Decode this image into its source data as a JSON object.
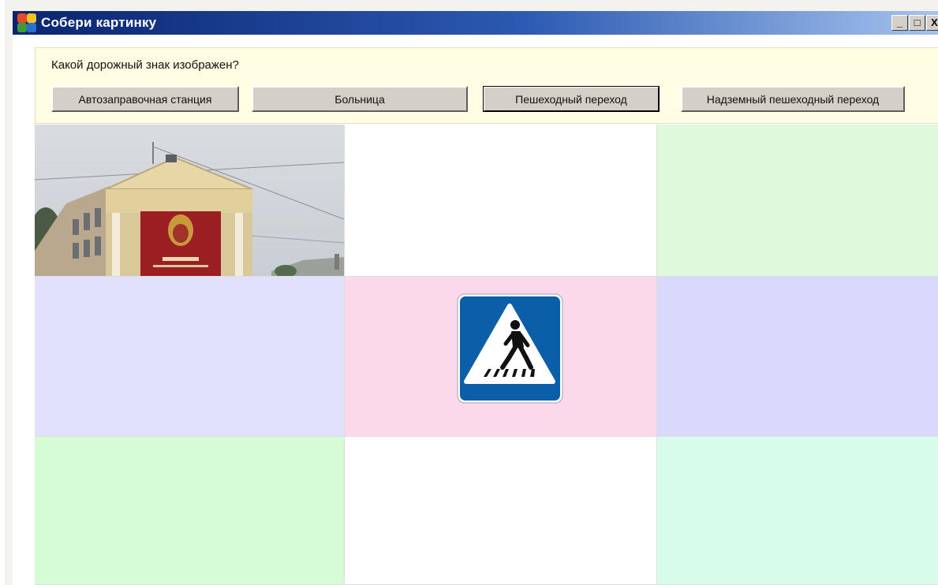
{
  "window": {
    "title": "Собери картинку",
    "controls": {
      "minimize": "_",
      "maximize": "□",
      "close": "X"
    }
  },
  "question": {
    "label": "Какой дорожный знак изображен?",
    "answers": [
      "Автозаправочная станция",
      "Больница",
      "Пешеходный переход",
      "Надземный пешеходный переход"
    ],
    "focused_answer": "Пешеходный переход"
  },
  "grid": {
    "rows": 3,
    "cols": 3,
    "tiles": [
      {
        "content": "photo-building",
        "color": "#ffffff"
      },
      {
        "content": "empty",
        "color": "#ffffff"
      },
      {
        "content": "empty",
        "color": "#dff9dd"
      },
      {
        "content": "empty",
        "color": "#e1e1fd"
      },
      {
        "content": "pedestrian-crossing-sign",
        "color": "#fbd8ea"
      },
      {
        "content": "empty",
        "color": "#d9d9fc"
      },
      {
        "content": "empty",
        "color": "#d6fcd6"
      },
      {
        "content": "empty",
        "color": "#ffffff"
      },
      {
        "content": "empty",
        "color": "#d7fcea"
      }
    ]
  },
  "colors": {
    "titlebar_start": "#0a2470",
    "titlebar_end": "#a6c4ee",
    "question_panel": "#fffde2",
    "button_face": "#d4d0c8",
    "sign_blue": "#0b5ea8"
  }
}
